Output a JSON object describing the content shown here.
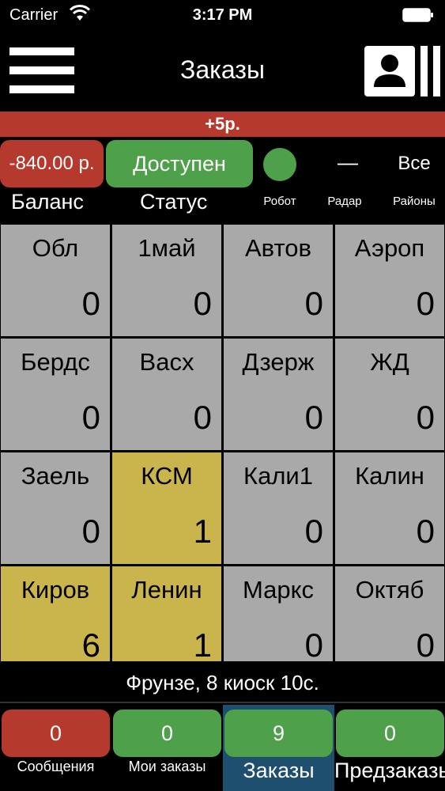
{
  "status_bar": {
    "carrier": "Carrier",
    "time": "3:17 PM"
  },
  "nav": {
    "title": "Заказы",
    "menu_icon": "hamburger-icon",
    "profile_icon": "contact-card-icon"
  },
  "banner": {
    "text": "+5р."
  },
  "controls": {
    "balance": "-840.00 р.",
    "status": "Доступен",
    "radar": "—",
    "districts": "Все",
    "labels": {
      "balance": "Баланс",
      "status": "Статус",
      "robot": "Робот",
      "radar": "Радар",
      "districts": "Районы"
    }
  },
  "districts_grid": [
    {
      "name": "Обл",
      "count": "0",
      "highlight": false
    },
    {
      "name": "1май",
      "count": "0",
      "highlight": false
    },
    {
      "name": "Автов",
      "count": "0",
      "highlight": false
    },
    {
      "name": "Аэроп",
      "count": "0",
      "highlight": false
    },
    {
      "name": "Бердс",
      "count": "0",
      "highlight": false
    },
    {
      "name": "Васх",
      "count": "0",
      "highlight": false
    },
    {
      "name": "Дзерж",
      "count": "0",
      "highlight": false
    },
    {
      "name": "ЖД",
      "count": "0",
      "highlight": false
    },
    {
      "name": "Заель",
      "count": "0",
      "highlight": false
    },
    {
      "name": "КСМ",
      "count": "1",
      "highlight": true
    },
    {
      "name": "Кали1",
      "count": "0",
      "highlight": false
    },
    {
      "name": "Калин",
      "count": "0",
      "highlight": false
    },
    {
      "name": "Киров",
      "count": "6",
      "highlight": true
    },
    {
      "name": "Ленин",
      "count": "1",
      "highlight": true
    },
    {
      "name": "Маркс",
      "count": "0",
      "highlight": false
    },
    {
      "name": "Октяб",
      "count": "0",
      "highlight": false
    }
  ],
  "footer_info": {
    "text": "Фрунзе, 8 киоск 10с."
  },
  "tabs": [
    {
      "count": "0",
      "label": "Сообщения",
      "color": "red",
      "active": false
    },
    {
      "count": "0",
      "label": "Мои заказы",
      "color": "green",
      "active": false
    },
    {
      "count": "9",
      "label": "Заказы",
      "color": "green",
      "active": true
    },
    {
      "count": "0",
      "label": "Предзаказы",
      "color": "green",
      "active": false
    }
  ],
  "colors": {
    "red": "#b53a2d",
    "green": "#4ea04a",
    "gray": "#a9a9a9",
    "yellow": "#c9b54c",
    "active_tab": "#1f4f6e"
  }
}
